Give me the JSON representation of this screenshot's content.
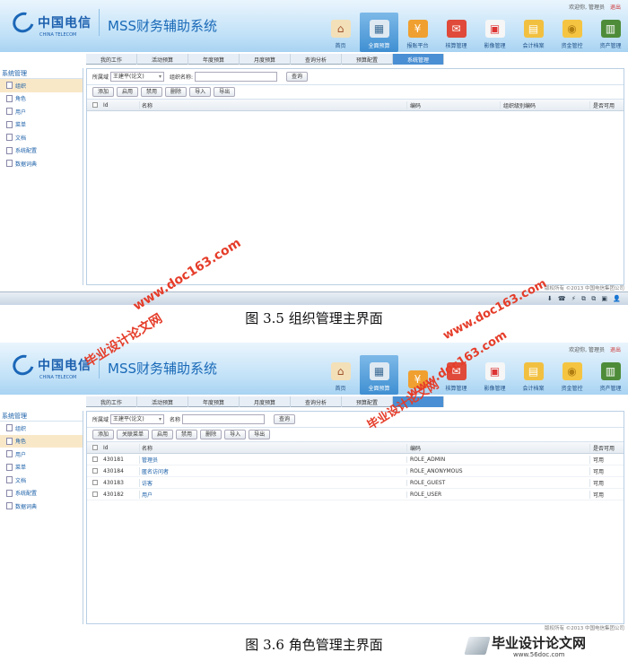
{
  "screens": [
    {
      "header": {
        "logo_cn": "中国电信",
        "logo_en": "CHINA TELECOM",
        "title": "MSS财务辅助系统",
        "welcome": "欢迎你, 管理员",
        "logout": "退出"
      },
      "nav": [
        {
          "label": "首页",
          "icon": "home-icon"
        },
        {
          "label": "全面预算",
          "icon": "calculator-icon",
          "active": true
        },
        {
          "label": "报账平台",
          "icon": "money-icon"
        },
        {
          "label": "核算管理",
          "icon": "mail-icon"
        },
        {
          "label": "影像管理",
          "icon": "image-icon"
        },
        {
          "label": "会计档案",
          "icon": "folder-icon"
        },
        {
          "label": "资金管控",
          "icon": "coins-icon"
        },
        {
          "label": "资产管理",
          "icon": "asset-icon"
        }
      ],
      "tabs": [
        "我的工作",
        "活动预算",
        "年度预算",
        "月度预算",
        "查询分析",
        "预算配置",
        "系统管理"
      ],
      "active_tab": 6,
      "sidebar": {
        "title": "系统管理",
        "items": [
          "组织",
          "角色",
          "用户",
          "菜单",
          "文档",
          "系统配置",
          "数据词典"
        ],
        "selected": 0
      },
      "filter": {
        "label1": "所属域",
        "select_value": "王建平(论文)",
        "label2": "组织名称:",
        "query": "查询"
      },
      "toolbar": [
        "添加",
        "启用",
        "禁用",
        "删除",
        "导入",
        "导出"
      ],
      "columns": [
        "Id",
        "名称",
        "编码",
        "组织级别编码",
        "是否可用"
      ],
      "rows": [],
      "footer": "版权所有 ©2013 中国电信集团公司"
    },
    {
      "header": {
        "logo_cn": "中国电信",
        "logo_en": "CHINA TELECOM",
        "title": "MSS财务辅助系统",
        "welcome": "欢迎你, 管理员",
        "logout": "退出"
      },
      "nav": [
        {
          "label": "首页",
          "icon": "home-icon"
        },
        {
          "label": "全面预算",
          "icon": "calculator-icon",
          "active": true
        },
        {
          "label": "",
          "icon": "money-icon"
        },
        {
          "label": "核算管理",
          "icon": "mail-icon"
        },
        {
          "label": "影像管理",
          "icon": "image-icon"
        },
        {
          "label": "会计档案",
          "icon": "folder-icon"
        },
        {
          "label": "资金管控",
          "icon": "coins-icon"
        },
        {
          "label": "资产管理",
          "icon": "asset-icon"
        }
      ],
      "tabs": [
        "我的工作",
        "活动预算",
        "年度预算",
        "月度预算",
        "查询分析",
        "预算配置",
        ""
      ],
      "active_tab": 6,
      "sidebar": {
        "title": "系统管理",
        "items": [
          "组织",
          "角色",
          "用户",
          "菜单",
          "文档",
          "系统配置",
          "数据词典"
        ],
        "selected": 1
      },
      "filter": {
        "label1": "所属域",
        "select_value": "王建平(论文)",
        "label2": "名称",
        "query": "查询"
      },
      "toolbar": [
        "添加",
        "关联菜单",
        "启用",
        "禁用",
        "删除",
        "导入",
        "导出"
      ],
      "columns": [
        "Id",
        "名称",
        "编码",
        "是否可用"
      ],
      "rows": [
        {
          "id": "430181",
          "name": "管理员",
          "code": "ROLE_ADMIN",
          "enabled": "可用"
        },
        {
          "id": "430184",
          "name": "匿名访问者",
          "code": "ROLE_ANONYMOUS",
          "enabled": "可用"
        },
        {
          "id": "430183",
          "name": "访客",
          "code": "ROLE_GUEST",
          "enabled": "可用"
        },
        {
          "id": "430182",
          "name": "用户",
          "code": "ROLE_USER",
          "enabled": "可用"
        }
      ],
      "footer": "版权所有 ©2013 中国电信集团公司"
    }
  ],
  "captions": [
    "图 3.5  组织管理主界面",
    "图 3.6  角色管理主界面"
  ],
  "watermarks": [
    "www.doc163.com",
    "毕业设计论文网",
    "毕业设计论文网",
    "www.doc163.com",
    "www.doc163.com"
  ],
  "site_badge": {
    "name": "毕业设计论文网",
    "url": "www.56doc.com"
  },
  "colors": {
    "accent": "#4a8fd3",
    "header_bg": "#bfe0f7",
    "link": "#1a5fa8",
    "watermark": "#e53d2a",
    "sidebar_selected": "#f9e8c8"
  },
  "taskbar_icons": "⬇ ☎ ⚡ ⧉ ⧉ ▣ 👤"
}
